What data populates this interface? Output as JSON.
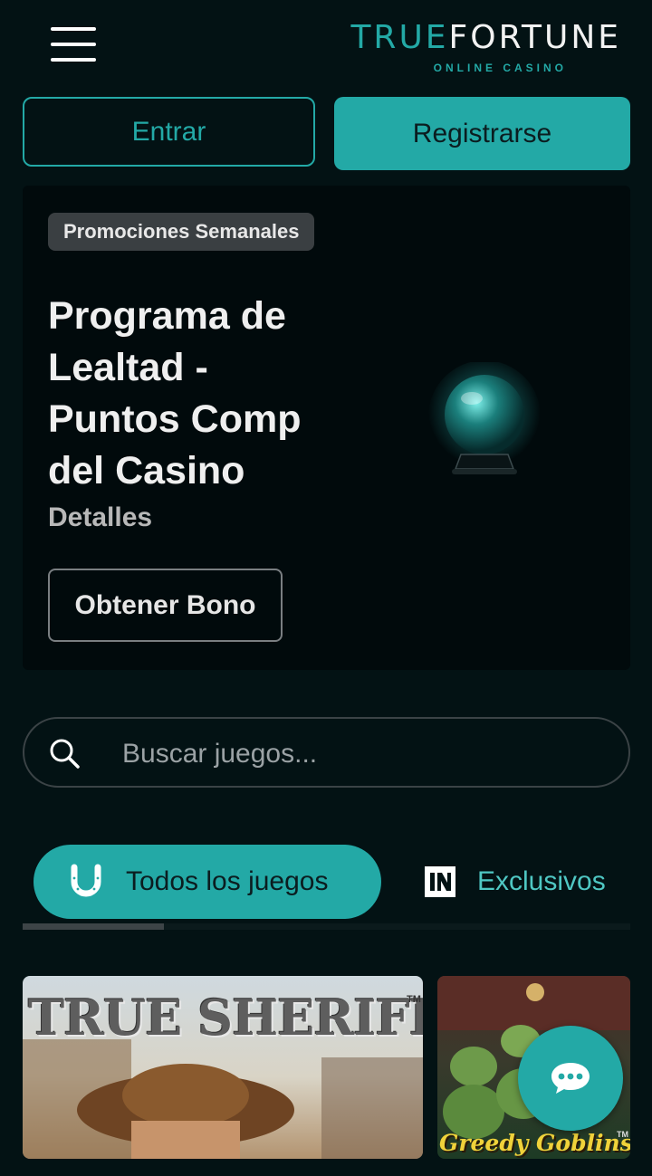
{
  "header": {
    "menu_icon": "hamburger-menu-icon",
    "logo": {
      "part1": "TRUE",
      "part2": "FORTUNE",
      "tagline": "ONLINE CASINO"
    }
  },
  "auth": {
    "login_label": "Entrar",
    "register_label": "Registrarse"
  },
  "promo": {
    "badge": "Promociones Semanales",
    "title": "Programa de Lealtad - Puntos Comp del Casino",
    "details_label": "Detalles",
    "cta_label": "Obtener Bono",
    "image_icon": "crystal-ball-icon"
  },
  "search": {
    "placeholder": "Buscar juegos...",
    "value": "",
    "icon": "search-icon"
  },
  "tabs": [
    {
      "label": "Todos los juegos",
      "icon": "horseshoe-icon",
      "active": true
    },
    {
      "label": "Exclusivos",
      "icon": "in-logo-icon",
      "active": false
    }
  ],
  "games": [
    {
      "title": "TRUE SHERIFF",
      "trademark": "TM"
    },
    {
      "title": "Greedy Goblins",
      "trademark": "TM"
    }
  ],
  "chat": {
    "icon": "chat-bubble-icon"
  },
  "colors": {
    "accent": "#23a9a6",
    "background": "#031214",
    "promo_bg": "#010a0c"
  }
}
